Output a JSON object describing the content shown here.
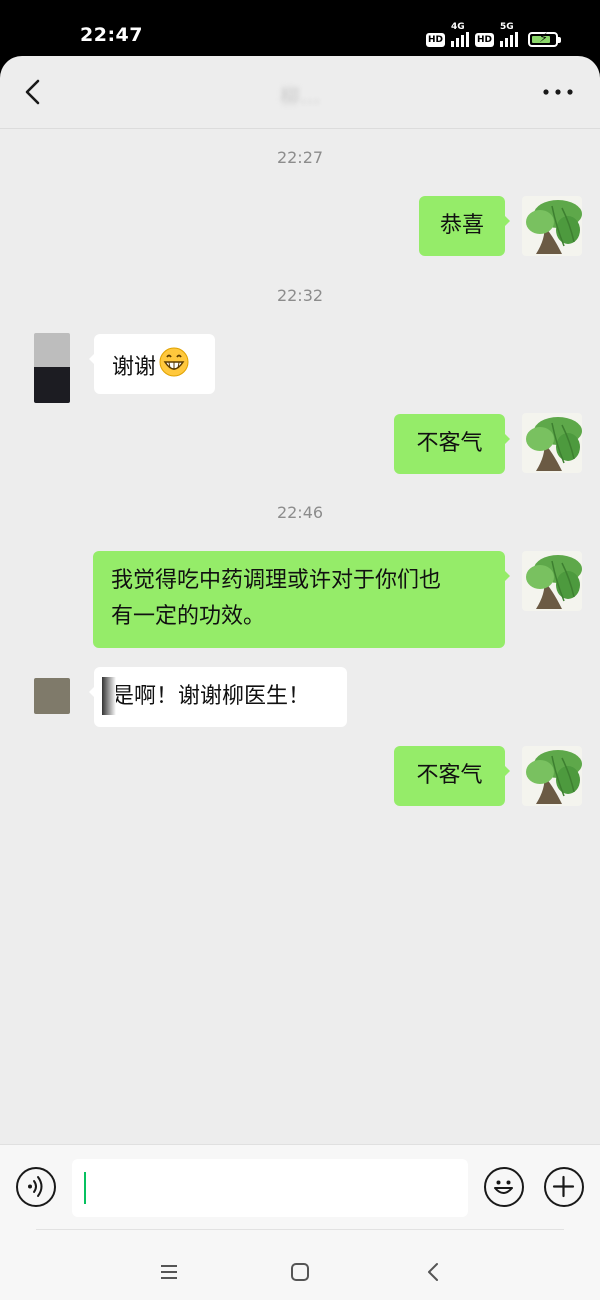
{
  "status_bar": {
    "time": "22:47",
    "network1": {
      "hd": "HD",
      "type": "4G"
    },
    "network2": {
      "hd": "HD",
      "type": "5G"
    },
    "battery_icon": "battery-charging-icon"
  },
  "header": {
    "title": "柳…",
    "back_icon": "chevron-left-icon",
    "more_icon": "more-horizontal-icon"
  },
  "messages": [
    {
      "type": "time",
      "text": "22:27"
    },
    {
      "type": "msg",
      "from": "me",
      "text": "恭喜"
    },
    {
      "type": "time",
      "text": "22:32"
    },
    {
      "type": "msg",
      "from": "them",
      "text": "谢谢"
    },
    {
      "type": "msg",
      "from": "me",
      "text": "不客气"
    },
    {
      "type": "time",
      "text": "22:46"
    },
    {
      "type": "msg",
      "from": "me",
      "line1": "我觉得吃中药调理或许对于你们也",
      "line2": "有一定的功效。"
    },
    {
      "type": "msg",
      "from": "them",
      "text": "是啊！谢谢柳医生！"
    },
    {
      "type": "msg",
      "from": "me",
      "text": "不客气"
    }
  ],
  "input_bar": {
    "voice_icon": "voice-icon",
    "input_value": "",
    "emoji_icon": "emoji-icon",
    "add_icon": "plus-circle-icon"
  },
  "nav_bar": {
    "menu_icon": "menu-icon",
    "home_icon": "home-square-icon",
    "back_icon": "nav-back-icon"
  },
  "colors": {
    "my_bubble": "#95ec69",
    "their_bubble": "#ffffff",
    "chat_bg": "#ededed",
    "caret": "#07c160"
  }
}
